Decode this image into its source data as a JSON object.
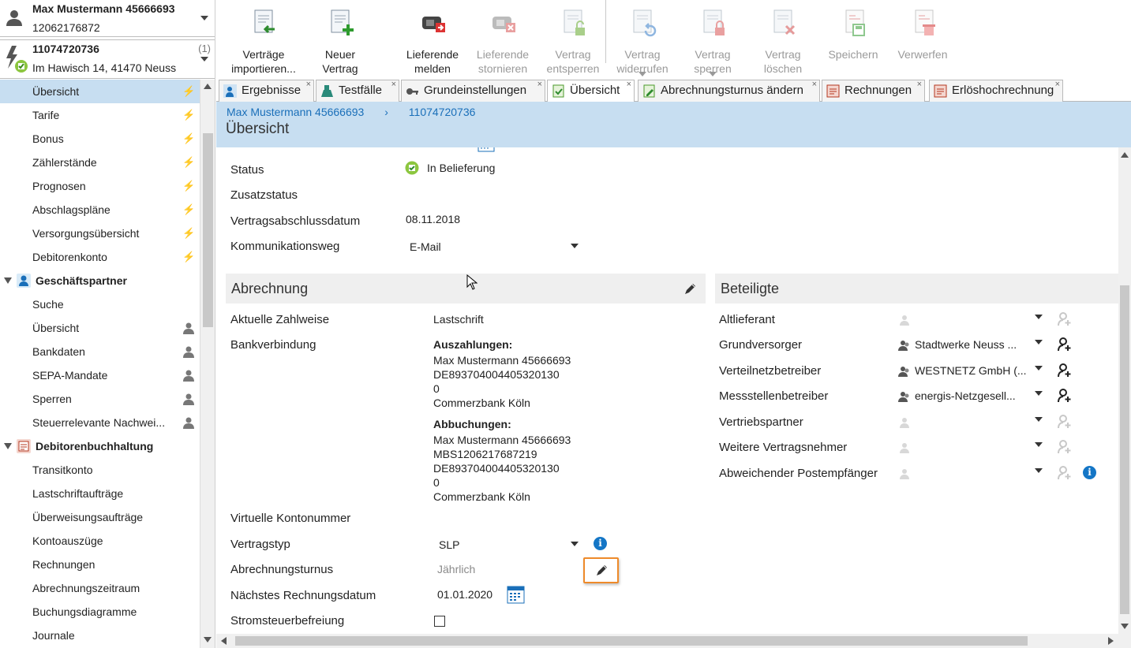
{
  "customer": {
    "name": "Max Mustermann 45666693",
    "number": "12062176872"
  },
  "contract": {
    "number": "11074720736",
    "address": "Im Hawisch 14, 41470 Neuss",
    "count": "(1)"
  },
  "nav": {
    "items": [
      {
        "label": "Übersicht",
        "active": true,
        "icon": "lightning-icon"
      },
      {
        "label": "Tarife",
        "icon": "lightning-icon"
      },
      {
        "label": "Bonus",
        "icon": "lightning-icon"
      },
      {
        "label": "Zählerstände",
        "icon": "lightning-icon"
      },
      {
        "label": "Prognosen",
        "icon": "lightning-icon"
      },
      {
        "label": "Abschlagspläne",
        "icon": "lightning-icon"
      },
      {
        "label": "Versorgungsübersicht",
        "icon": "lightning-icon"
      },
      {
        "label": "Debitorenkonto",
        "icon": "lightning-icon"
      }
    ],
    "group_partner": {
      "label": "Geschäftspartner",
      "icon": "business-partner-icon"
    },
    "partner_items": [
      {
        "label": "Suche"
      },
      {
        "label": "Übersicht",
        "icon": "person-icon"
      },
      {
        "label": "Bankdaten",
        "icon": "person-icon"
      },
      {
        "label": "SEPA-Mandate",
        "icon": "person-icon"
      },
      {
        "label": "Sperren",
        "icon": "person-icon"
      },
      {
        "label": "Steuerrelevante Nachwei...",
        "icon": "person-icon"
      }
    ],
    "group_debitor": {
      "label": "Debitorenbuchhaltung",
      "icon": "accounting-icon"
    },
    "debitor_items": [
      {
        "label": "Transitkonto"
      },
      {
        "label": "Lastschriftaufträge"
      },
      {
        "label": "Überweisungsaufträge"
      },
      {
        "label": "Kontoauszüge"
      },
      {
        "label": "Rechnungen"
      },
      {
        "label": "Abrechnungszeitraum"
      },
      {
        "label": "Buchungsdiagramme"
      },
      {
        "label": "Journale"
      }
    ]
  },
  "toolbar": {
    "import": "Verträge\nimportieren...",
    "new": "Neuer\nVertrag",
    "report_delivery": "Lieferende\nmelden",
    "cancel_delivery": "Lieferende\nstornieren",
    "unlock": "Vertrag\nentsperren",
    "revoke": "Vertrag\nwiderrufen",
    "lock": "Vertrag\nsperren",
    "delete": "Vertrag\nlöschen",
    "save": "Speichern",
    "discard": "Verwerfen"
  },
  "tabs": [
    {
      "label": "Ergebnisse",
      "icon": "results-icon"
    },
    {
      "label": "Testfälle",
      "icon": "flask-icon"
    },
    {
      "label": "Grundeinstellungen",
      "icon": "key-icon"
    },
    {
      "label": "Übersicht",
      "icon": "contract-check-icon",
      "active": true
    },
    {
      "label": "Abrechnungsturnus ändern",
      "icon": "contract-edit-icon"
    },
    {
      "label": "Rechnungen",
      "icon": "invoice-icon"
    },
    {
      "label": "Erlöshochrechnung",
      "icon": "invoice-icon"
    }
  ],
  "breadcrumb": {
    "item1": "Max Mustermann 45666693",
    "sep": "›",
    "item2": "11074720736"
  },
  "page_title": "Übersicht",
  "contract_fields": {
    "status_label": "Status",
    "status_value": "In Belieferung",
    "zusatz_label": "Zusatzstatus",
    "abschluss_label": "Vertragsabschlussdatum",
    "abschluss_value": "08.11.2018",
    "kommunikation_label": "Kommunikationsweg",
    "kommunikation_value": "E-Mail"
  },
  "abrechnung": {
    "title": "Abrechnung",
    "zahlweise_label": "Aktuelle Zahlweise",
    "zahlweise_value": "Lastschrift",
    "bank_label": "Bankverbindung",
    "auszahlungen_title": "Auszahlungen:",
    "auszahlungen_lines": [
      "Max Mustermann 45666693",
      "DE893704004405320130",
      "0",
      "Commerzbank Köln"
    ],
    "abbuchungen_title": "Abbuchungen:",
    "abbuchungen_lines": [
      "Max Mustermann 45666693",
      "MBS1206217687219",
      "DE893704004405320130",
      "0",
      "Commerzbank Köln"
    ],
    "virtuell_label": "Virtuelle Kontonummer",
    "vertragstyp_label": "Vertragstyp",
    "vertragstyp_value": "SLP",
    "turnus_label": "Abrechnungsturnus",
    "turnus_value": "Jährlich",
    "naechstes_label": "Nächstes Rechnungsdatum",
    "naechstes_value": "01.01.2020",
    "stromsteuer_label": "Stromsteuerbefreiung",
    "stromsteuer_checked": false
  },
  "beteiligte": {
    "title": "Beteiligte",
    "rows": [
      {
        "label": "Altlieferant",
        "value": ""
      },
      {
        "label": "Grundversorger",
        "value": "Stadtwerke Neuss ..."
      },
      {
        "label": "Verteilnetzbetreiber",
        "value": "WESTNETZ GmbH (..."
      },
      {
        "label": "Messstellenbetreiber",
        "value": "energis-Netzgesell..."
      },
      {
        "label": "Vertriebspartner",
        "value": ""
      },
      {
        "label": "Weitere Vertragsnehmer",
        "value": ""
      },
      {
        "label": "Abweichender Postempfänger",
        "value": ""
      }
    ]
  },
  "colors": {
    "accent": "#1a6fb9",
    "header_bg": "#c7def1",
    "highlight": "#ee8a2a"
  }
}
